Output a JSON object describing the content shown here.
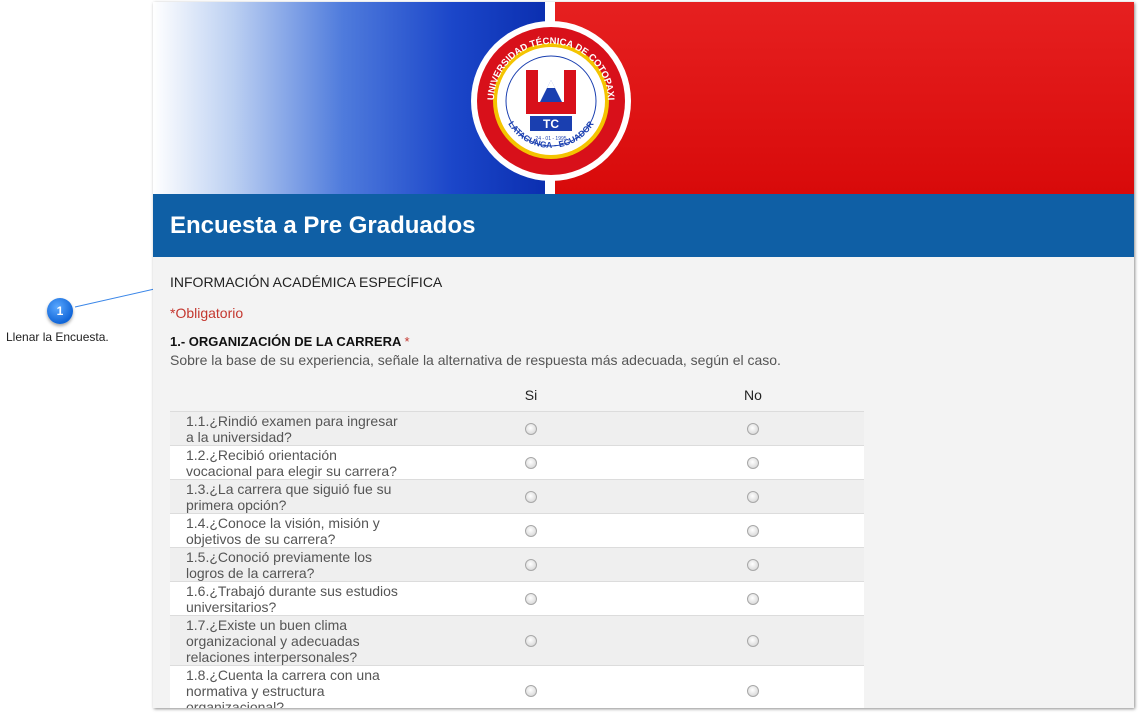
{
  "callout": {
    "number": "1",
    "label": "Llenar la Encuesta."
  },
  "banner": {
    "seal_text_top": "UNIVERSIDAD TÉCNICA DE COTOPAXI",
    "seal_text_bottom": "LATACUNGA - ECUADOR",
    "seal_date": "24 - 01 - 1995",
    "colors": {
      "blue": "#0b2fb0",
      "red": "#e01010"
    }
  },
  "form": {
    "title": "Encuesta a Pre Graduados",
    "section_title": "INFORMACIÓN ACADÉMICA ESPECÍFICA",
    "required_note": "*Obligatorio",
    "question": {
      "title": "1.- ORGANIZACIÓN DE LA CARRERA",
      "required_mark": "*",
      "help": "Sobre la base de su experiencia, señale la alternativa de respuesta más adecuada, según el caso.",
      "columns": [
        "Si",
        "No"
      ],
      "rows": [
        {
          "label_lines": [
            "1.1.¿Rindió examen para ingresar",
            "a la universidad?"
          ]
        },
        {
          "label_lines": [
            "1.2.¿Recibió orientación",
            "vocacional para elegir su carrera?"
          ]
        },
        {
          "label_lines": [
            "1.3.¿La carrera que siguió fue su",
            "primera opción?"
          ]
        },
        {
          "label_lines": [
            "1.4.¿Conoce la visión, misión y",
            "objetivos de su carrera?"
          ]
        },
        {
          "label_lines": [
            "1.5.¿Conoció previamente los",
            "logros de la carrera?"
          ]
        },
        {
          "label_lines": [
            "1.6.¿Trabajó durante sus estudios",
            "universitarios?"
          ]
        },
        {
          "label_lines": [
            "1.7.¿Existe un buen  clima",
            "organizacional y adecuadas",
            "relaciones interpersonales?"
          ]
        },
        {
          "label_lines": [
            "1.8.¿Cuenta la carrera con una",
            "normativa y estructura",
            "organizacional?"
          ]
        }
      ]
    }
  },
  "colors": {
    "title_bar": "#0f5fa5",
    "required": "#c4372f",
    "callout": "#1166d8"
  }
}
